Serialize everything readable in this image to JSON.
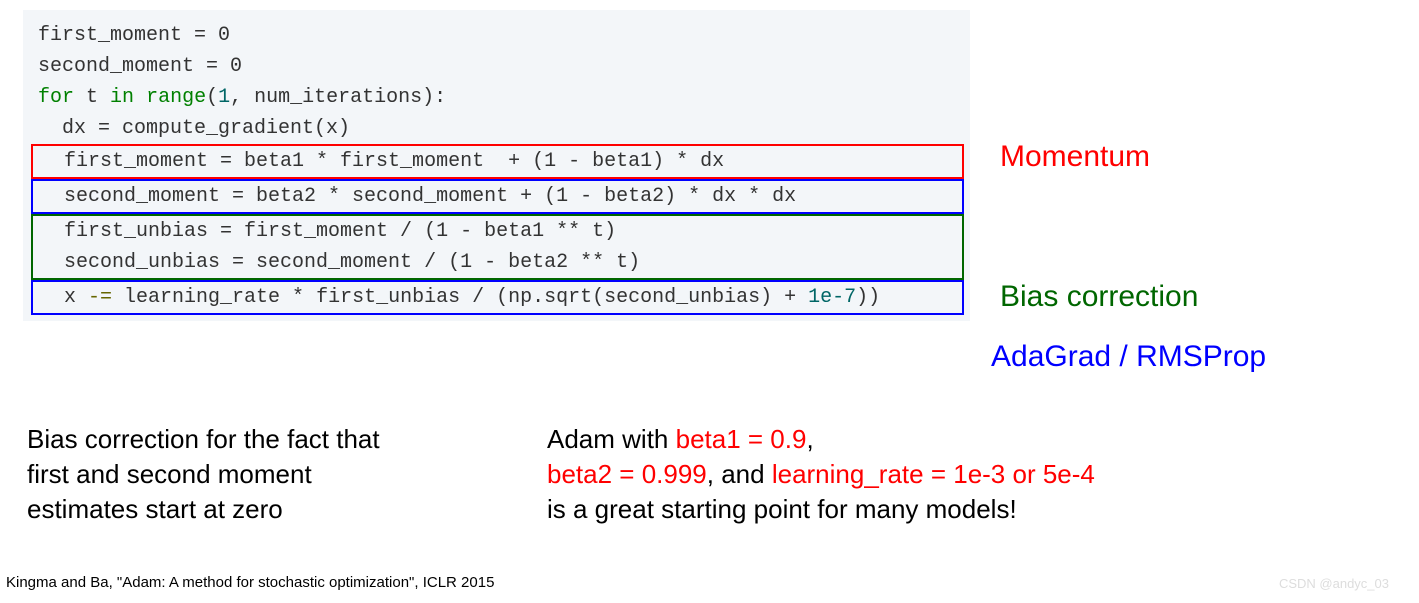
{
  "code": {
    "l1": "first_moment = 0",
    "l2": "second_moment = 0",
    "l3_for": "for",
    "l3_t": " t ",
    "l3_in": "in",
    "l3_sp": " ",
    "l3_range": "range",
    "l3_open": "(",
    "l3_one": "1",
    "l3_rest": ", num_iterations):",
    "l4": "  dx = compute_gradient(x)",
    "l5": "  first_moment = beta1 * first_moment  + (1 - beta1) * dx",
    "l6": "  second_moment = beta2 * second_moment + (1 - beta2) * dx * dx",
    "l7": "  first_unbias = first_moment / (1 - beta1 ** t)",
    "l8": "  second_unbias = second_moment / (1 - beta2 ** t)",
    "l9a": "  x ",
    "l9b": "-=",
    "l9c": " learning_rate * first_unbias / (np.sqrt(second_unbias) + ",
    "l9d": "1e-7",
    "l9e": "))"
  },
  "labels": {
    "momentum": "Momentum",
    "bias": "Bias correction",
    "adagrad": "AdaGrad / RMSProp"
  },
  "note_left": {
    "l1": "Bias correction for the fact that",
    "l2": "first and second moment",
    "l3": "estimates start at zero"
  },
  "note_right": {
    "r1a": "Adam with ",
    "r1b": "beta1 = 0.9",
    "r1c": ",",
    "r2a": "beta2 = 0.999",
    "r2b": ", and ",
    "r2c": "learning_rate = 1e-3 or 5e-4",
    "r3": "is a great starting point for many models!"
  },
  "citation": "Kingma and Ba, \"Adam: A method for stochastic optimization\", ICLR 2015",
  "watermark": "CSDN @andyc_03"
}
